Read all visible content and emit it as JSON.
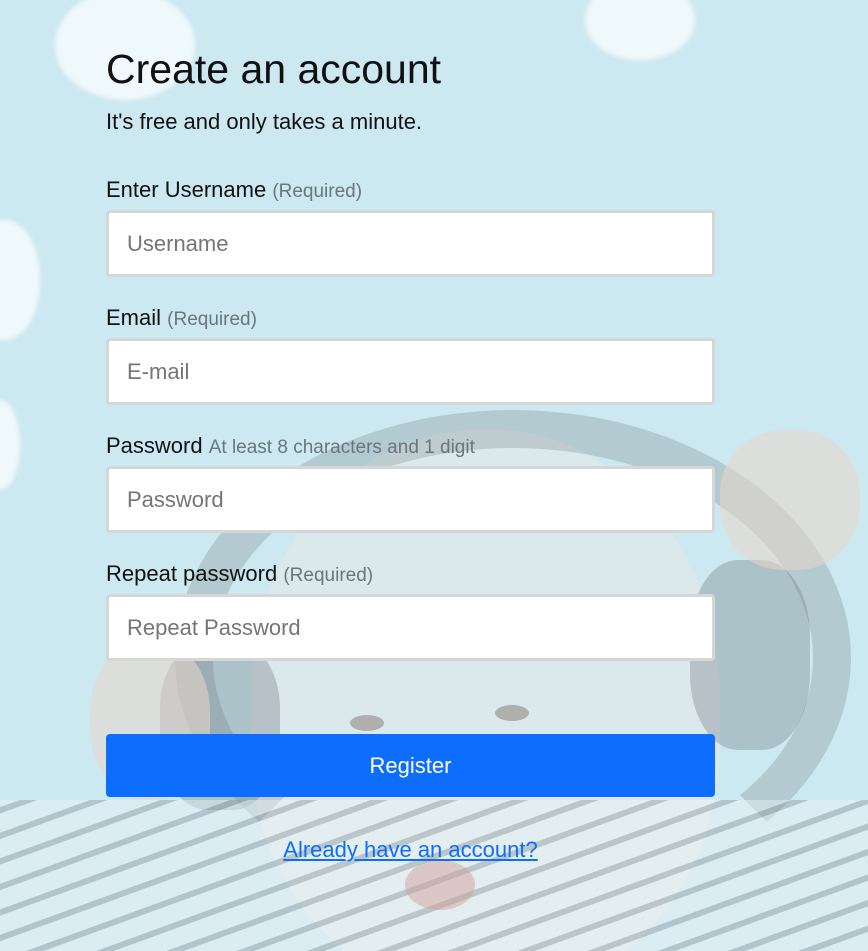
{
  "form": {
    "title": "Create an account",
    "subtitle": "It's free and only takes a minute.",
    "fields": [
      {
        "label": "Enter Username",
        "hint": "(Required)",
        "placeholder": "Username",
        "value": ""
      },
      {
        "label": "Email",
        "hint": "(Required)",
        "placeholder": "E-mail",
        "value": ""
      },
      {
        "label": "Password",
        "hint": "At least 8 characters and 1 digit",
        "placeholder": "Password",
        "value": ""
      },
      {
        "label": "Repeat password",
        "hint": "(Required)",
        "placeholder": "Repeat Password",
        "value": ""
      }
    ],
    "register_label": "Register",
    "login_link_label": "Already have an account?"
  },
  "colors": {
    "primary": "#0d6efd",
    "hint_text": "#6c757d",
    "background": "#bfe3ec"
  }
}
